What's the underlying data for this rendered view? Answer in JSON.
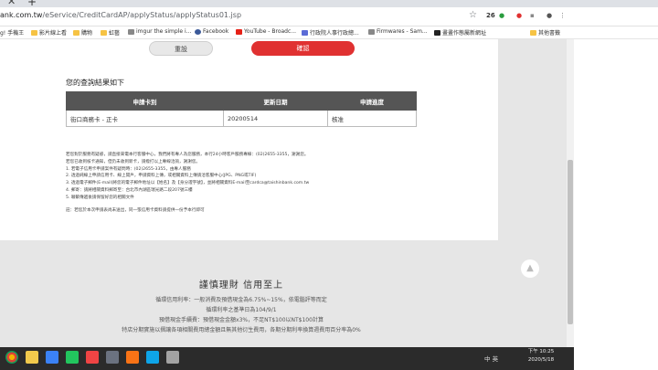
{
  "browser": {
    "url_host": "ank.com.tw",
    "url_path": "/eService/CreditCardAP/applyStatus/applyStatus01.jsp",
    "ext_badge": "26"
  },
  "bookmarks": [
    {
      "label": "g! 手機王",
      "icon": "folder-icon"
    },
    {
      "label": "影片線上看",
      "icon": "folder-icon"
    },
    {
      "label": "購物",
      "icon": "folder-icon"
    },
    {
      "label": "虹藝",
      "icon": "folder-icon"
    },
    {
      "label": "imgur the simple i...",
      "icon": "imgur-icon"
    },
    {
      "label": "Facebook",
      "icon": "facebook-icon"
    },
    {
      "label": "YouTube - Broadc...",
      "icon": "youtube-icon"
    },
    {
      "label": "行政院人事行政總...",
      "icon": "gov-icon"
    },
    {
      "label": "Firmwares - Sam...",
      "icon": "file-icon"
    },
    {
      "label": "畫畫作態屬新網址",
      "icon": "book-icon"
    },
    {
      "label": "其他書籤",
      "icon": "folder-icon"
    }
  ],
  "form": {
    "reset_label": "重設",
    "confirm_label": "確認"
  },
  "result": {
    "title": "您的查詢結果如下",
    "headers": [
      "申請卡別",
      "更新日期",
      "申請進度"
    ],
    "rows": [
      {
        "card": "街口商務卡 - 正卡",
        "date": "20200514",
        "status": "核准"
      }
    ]
  },
  "notes": [
    "若您對於服務有疑惑，請直接來電本行客服中心，我們將有專人為您服務，本行24小時客戶服務專線：(02)2655-3355，謝謝您。",
    "若您已收到核卡通知，但仍未收到新卡，請撥打以上專線洽詢，謝謝您。",
    "1. 若電子信用卡申請案件有疑問時：(02)2655-3355，由專人服務",
    "2. 透過純線上申請信用卡、線上開戶，申請資料上傳，或相關資料上傳請洽客服中心(JPG、PNG或TIF)",
    "3. 透過電子郵件(E-mail)將您的電子郵件地址以【姓名】及【身分證字號】，並將相關資料E-mail至cardca@taishinbank.com.tw",
    "4. 郵寄：請將相關資料郵寄至：台北市內湖區瑞光路二段207號三樓",
    "5. 聯繫傳遞後請保留好您的相關文件"
  ],
  "notes_tail": "註：若您於本次申請表尚未送出，同一張信用卡資料請提供一份予本行即可",
  "footer": {
    "title": "謹慎理財 信用至上",
    "lines": [
      "循環信用利率：一般消費及預借現金為6.75%~15%，依電腦評等而定",
      "循環利率之基準日為104/9/1",
      "預借現金手續費：預借現金金額x3%，不足NT$100以NT$100計算",
      "特店分期實施以摺讓各項相關費用總金額且無其他衍生費用，各期分期利率換算週費用百分率為0%"
    ]
  },
  "taskbar": {
    "tray_text": "中 英",
    "time": "下午 10:25",
    "date": "2020/5/18"
  }
}
